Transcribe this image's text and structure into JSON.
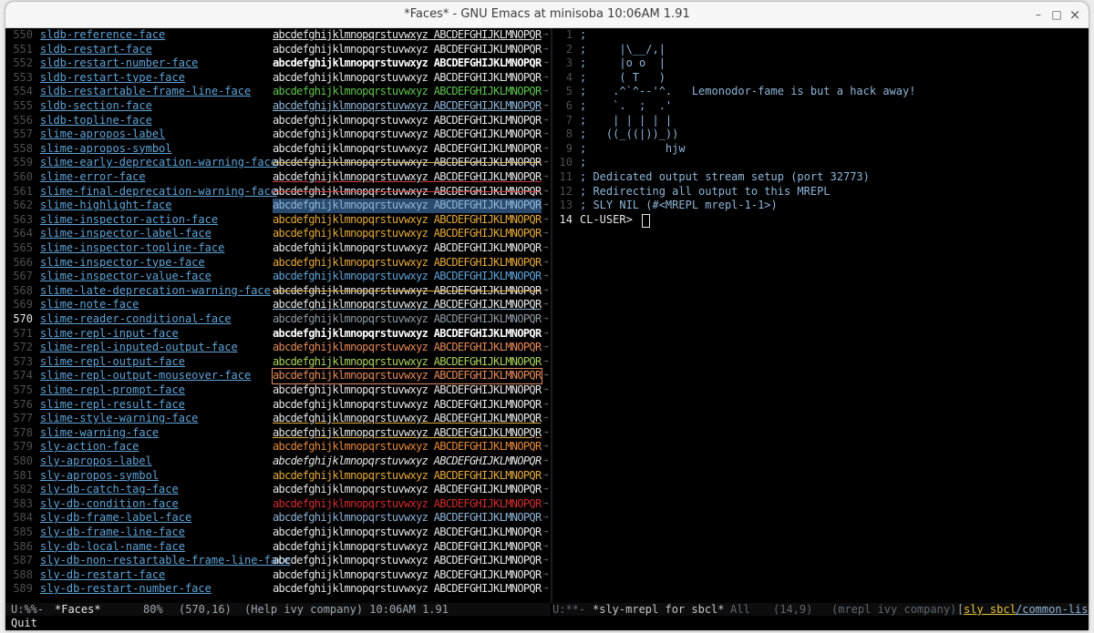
{
  "window": {
    "title": "*Faces* - GNU Emacs at minisoba 10:06AM 1.91",
    "btn_min": "–",
    "btn_max": "□",
    "btn_close": "×"
  },
  "faces_buffer": {
    "sample_text": "abcdefghijklmnopqrstuvwxyz ABCDEFGHIJKLMNOPQR",
    "overflow_marker": "→",
    "cursor_line": 570,
    "rows": [
      {
        "n": "550",
        "name": "sldb-reference-face",
        "color": "#e6e6e6",
        "ul": "#e6e6e6"
      },
      {
        "n": "551",
        "name": "sldb-restart-face",
        "color": "#e6e6e6"
      },
      {
        "n": "552",
        "name": "sldb-restart-number-face",
        "color": "#ffffff",
        "bold": true
      },
      {
        "n": "553",
        "name": "sldb-restart-type-face",
        "color": "#e6e6e6"
      },
      {
        "n": "554",
        "name": "sldb-restartable-frame-line-face",
        "color": "#5ec44d"
      },
      {
        "n": "555",
        "name": "sldb-section-face",
        "color": "#8fb5d8",
        "ul": "#8fb5d8"
      },
      {
        "n": "556",
        "name": "sldb-topline-face",
        "color": "#e6e6e6"
      },
      {
        "n": "557",
        "name": "slime-apropos-label",
        "color": "#e6e6e6"
      },
      {
        "n": "558",
        "name": "slime-apropos-symbol",
        "color": "#e6e6e6"
      },
      {
        "n": "559",
        "name": "slime-early-deprecation-warning-face",
        "color": "#e6e6e6",
        "strike": "#d4b35a"
      },
      {
        "n": "560",
        "name": "slime-error-face",
        "color": "#e6e6e6",
        "ul": "#d43b3b"
      },
      {
        "n": "561",
        "name": "slime-final-deprecation-warning-face",
        "color": "#e6e6e6",
        "strike": "#d43b3b"
      },
      {
        "n": "562",
        "name": "slime-highlight-face",
        "color": "#8fb5d8",
        "bg": "#2a4a6e"
      },
      {
        "n": "563",
        "name": "slime-inspector-action-face",
        "color": "#e5a93a"
      },
      {
        "n": "564",
        "name": "slime-inspector-label-face",
        "color": "#e5a93a"
      },
      {
        "n": "565",
        "name": "slime-inspector-topline-face",
        "color": "#e6e6e6"
      },
      {
        "n": "566",
        "name": "slime-inspector-type-face",
        "color": "#e5a93a"
      },
      {
        "n": "567",
        "name": "slime-inspector-value-face",
        "color": "#5fa3d8"
      },
      {
        "n": "568",
        "name": "slime-late-deprecation-warning-face",
        "color": "#e6e6e6",
        "strike": "#e5a93a"
      },
      {
        "n": "569",
        "name": "slime-note-face",
        "color": "#e6e6e6",
        "ul": "#8fb5d8"
      },
      {
        "n": "570",
        "name": "slime-reader-conditional-face",
        "color": "#8f9aa5"
      },
      {
        "n": "571",
        "name": "slime-repl-input-face",
        "color": "#ffffff",
        "bold": true
      },
      {
        "n": "572",
        "name": "slime-repl-inputed-output-face",
        "color": "#e5895a"
      },
      {
        "n": "573",
        "name": "slime-repl-output-face",
        "color": "#a9d35a"
      },
      {
        "n": "574",
        "name": "slime-repl-output-mouseover-face",
        "color": "#e5895a",
        "box": "#e5895a"
      },
      {
        "n": "575",
        "name": "slime-repl-prompt-face",
        "color": "#e6e6e6"
      },
      {
        "n": "576",
        "name": "slime-repl-result-face",
        "color": "#e6e6e6"
      },
      {
        "n": "577",
        "name": "slime-style-warning-face",
        "color": "#e6e6e6",
        "ul": "#e5a93a"
      },
      {
        "n": "578",
        "name": "slime-warning-face",
        "color": "#e6e6e6",
        "ul": "#e5a93a"
      },
      {
        "n": "579",
        "name": "sly-action-face",
        "color": "#e5893a"
      },
      {
        "n": "580",
        "name": "sly-apropos-label",
        "color": "#e6e6e6",
        "italic": true
      },
      {
        "n": "581",
        "name": "sly-apropos-symbol",
        "color": "#e5a93a"
      },
      {
        "n": "582",
        "name": "sly-db-catch-tag-face",
        "color": "#e6e6e6"
      },
      {
        "n": "583",
        "name": "sly-db-condition-face",
        "color": "#d42b2b"
      },
      {
        "n": "584",
        "name": "sly-db-frame-label-face",
        "color": "#8fb5d8"
      },
      {
        "n": "585",
        "name": "sly-db-frame-line-face",
        "color": "#e6e6e6"
      },
      {
        "n": "586",
        "name": "sly-db-local-name-face",
        "color": "#e6e6e6"
      },
      {
        "n": "587",
        "name": "sly-db-non-restartable-frame-line-face",
        "color": "#e6e6e6"
      },
      {
        "n": "588",
        "name": "sly-db-restart-face",
        "color": "#e6e6e6"
      },
      {
        "n": "589",
        "name": "sly-db-restart-number-face",
        "color": "#e6e6e6"
      }
    ]
  },
  "repl_buffer": {
    "lines": [
      {
        "n": "1",
        "text": ";"
      },
      {
        "n": "2",
        "text": ";     |\\__/,|"
      },
      {
        "n": "3",
        "text": ";     |o o  |"
      },
      {
        "n": "4",
        "text": ";     ( T   )"
      },
      {
        "n": "5",
        "text": ";    .^`^--'^.   Lemonodor-fame is but a hack away!"
      },
      {
        "n": "6",
        "text": ";    `.  ;  .'"
      },
      {
        "n": "7",
        "text": ";    | | | | |"
      },
      {
        "n": "8",
        "text": ";   ((_((|))_))"
      },
      {
        "n": "9",
        "text": ";            hjw"
      },
      {
        "n": "10",
        "text": ";"
      },
      {
        "n": "11",
        "text": "; Dedicated output stream setup (port 32773)"
      },
      {
        "n": "12",
        "text": "; Redirecting all output to this MREPL"
      },
      {
        "n": "13",
        "text": "; SLY NIL (#<MREPL mrepl-1-1>)"
      }
    ],
    "prompt_line": "14",
    "prompt": "CL-USER>"
  },
  "modeline_left": {
    "state": "U:%%-",
    "buffer": "*Faces*",
    "percent": "80%",
    "position": "(570,16)",
    "modes": "(Help ivy company) 10:06AM 1.91"
  },
  "modeline_right": {
    "state": "U:**-",
    "buffer": "*sly-mrepl for sbcl*",
    "percent": "All",
    "position": "(14,9)",
    "modes": "(mrepl ivy company)",
    "sly_bracket": "[",
    "sly_label": "sly sbcl",
    "sly_rest": "/common-lisp-"
  },
  "echo_area": {
    "text": "Quit"
  }
}
